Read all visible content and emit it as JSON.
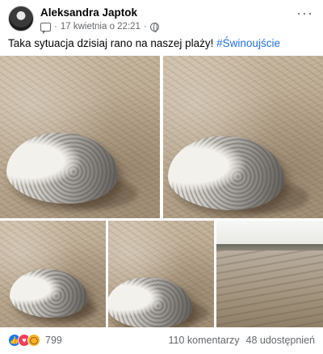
{
  "post": {
    "author": "Aleksandra Japtok",
    "date": "17 kwietnia o 22:21",
    "date_separator": "·",
    "text": "Taka sytuacja dzisiaj rano na naszej plaży!",
    "hashtag": "#Świnoujście",
    "more_icon": "···"
  },
  "photos": [
    {
      "name": "seal-photo-1"
    },
    {
      "name": "seal-photo-2"
    },
    {
      "name": "seal-photo-3"
    },
    {
      "name": "seal-photo-4"
    },
    {
      "name": "beach-photo-5"
    }
  ],
  "footer": {
    "reactions": [
      "like",
      "love",
      "wow"
    ],
    "reaction_count": "799",
    "comments": "110 komentarzy",
    "shares": "48 udostępnień"
  },
  "colors": {
    "link": "#216fdb",
    "secondary_text": "#65676b",
    "like": "#1877f2",
    "love": "#f33e58",
    "wow": "#f7b125"
  }
}
